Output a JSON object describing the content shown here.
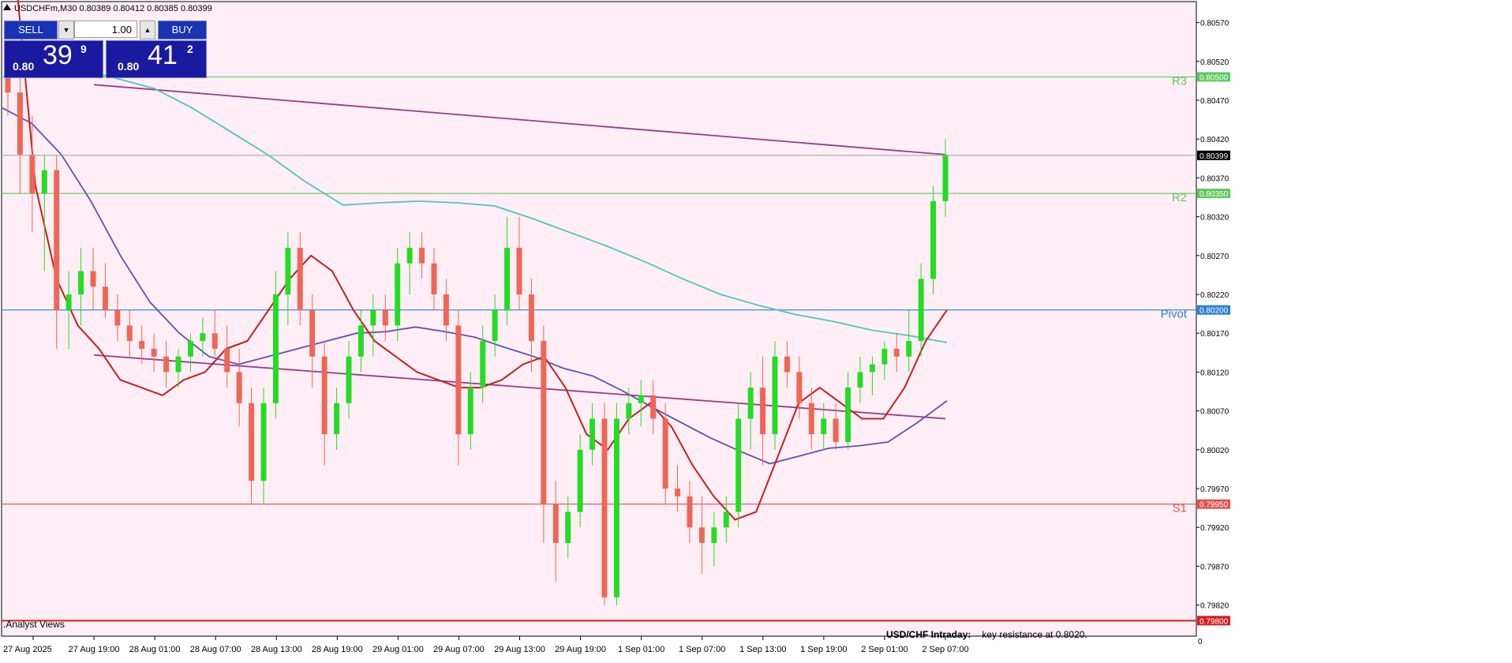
{
  "header": {
    "symbol_line": "USDCHFm,M30  0.80389 0.80412 0.80385 0.80399"
  },
  "trade_panel": {
    "sell_label": "SELL",
    "buy_label": "BUY",
    "lot_value": "1.00",
    "sell_price_prefix": "0.80",
    "sell_price_big": "39",
    "sell_price_sup": "9",
    "buy_price_prefix": "0.80",
    "buy_price_big": "41",
    "buy_price_sup": "2"
  },
  "footer": {
    "analyst": "Analyst Views",
    "intraday_title": "USD/CHF Intraday:",
    "intraday_text": "key resistance at 0.8020."
  },
  "chart_data": {
    "type": "candlestick",
    "symbol": "USDCHFm",
    "timeframe": "M30",
    "ylim": [
      0.7978,
      0.80597
    ],
    "y_ticks": [
      "0.80570",
      "0.80520",
      "0.80470",
      "0.80420",
      "0.80370",
      "0.80320",
      "0.80270",
      "0.80220",
      "0.80170",
      "0.80120",
      "0.80070",
      "0.80020",
      "0.79970",
      "0.79920",
      "0.79870",
      "0.79820"
    ],
    "current_price": "0.80399",
    "x_labels": [
      "27 Aug 2025",
      "27 Aug 19:00",
      "28 Aug 01:00",
      "28 Aug 07:00",
      "28 Aug 13:00",
      "28 Aug 19:00",
      "29 Aug 01:00",
      "29 Aug 07:00",
      "29 Aug 13:00",
      "29 Aug 19:00",
      "1 Sep 01:00",
      "1 Sep 07:00",
      "1 Sep 13:00",
      "1 Sep 19:00",
      "2 Sep 01:00",
      "2 Sep 07:00"
    ],
    "levels": [
      {
        "name": "R3",
        "value": 0.805,
        "label": "0.80500",
        "color": "#5ec95e"
      },
      {
        "name": "R2",
        "value": 0.8035,
        "label": "0.80350",
        "color": "#5ec95e"
      },
      {
        "name": "Pivot",
        "value": 0.802,
        "label": "0.80200",
        "color": "#2a7fd4"
      },
      {
        "name": "S1",
        "value": 0.7995,
        "label": "0.79950",
        "color": "#e05050"
      },
      {
        "name": "",
        "value": 0.798,
        "label": "0.79800",
        "color": "#d02020"
      }
    ],
    "trendlines": [
      {
        "from": [
          "27 Aug 19:00",
          0.8049
        ],
        "to": [
          "2 Sep 07:00",
          0.804
        ],
        "color": "#9b3a8a"
      },
      {
        "from": [
          "27 Aug 19:00",
          0.80142
        ],
        "to": [
          "2 Sep 07:00",
          0.8006
        ],
        "color": "#9b3a8a"
      }
    ],
    "ma_fast": [
      0.8065,
      0.8036,
      0.8024,
      0.8018,
      0.8015,
      0.8011,
      0.801,
      0.8009,
      0.8011,
      0.8012,
      0.8015,
      0.8016,
      0.802,
      0.8024,
      0.8027,
      0.8025,
      0.802,
      0.8016,
      0.8014,
      0.8012,
      0.8011,
      0.801,
      0.801,
      0.8011,
      0.8013,
      0.8014,
      0.801,
      0.8004,
      0.8002,
      0.8006,
      0.8008,
      0.8005,
      0.8,
      0.7996,
      0.7993,
      0.7994,
      0.8001,
      0.8008,
      0.801,
      0.8008,
      0.8006,
      0.8006,
      0.801,
      0.8016,
      0.802
    ],
    "ma_mid": [
      0.8046,
      0.8044,
      0.804,
      0.8034,
      0.8027,
      0.8021,
      0.8017,
      0.8014,
      0.8013,
      0.8014,
      0.8015,
      0.8016,
      0.8017,
      0.80172,
      0.80178,
      0.80172,
      0.80165,
      0.80152,
      0.8014,
      0.80125,
      0.80115,
      0.80096,
      0.80075,
      0.80055,
      0.80035,
      0.80018,
      0.80002,
      0.80012,
      0.80022,
      0.80025,
      0.8003,
      0.80055,
      0.80083
    ],
    "ma_slow": [
      0.8051,
      0.80498,
      0.80485,
      0.8046,
      0.8043,
      0.804,
      0.80365,
      0.80335,
      0.80338,
      0.8034,
      0.80338,
      0.80334,
      0.80318,
      0.803,
      0.80282,
      0.80262,
      0.8024,
      0.8022,
      0.80206,
      0.80194,
      0.80185,
      0.80174,
      0.80167,
      0.80158
    ],
    "candles": [
      [
        0.8052,
        0.8052,
        0.8045,
        0.8048
      ],
      [
        0.8048,
        0.8052,
        0.8035,
        0.804
      ],
      [
        0.804,
        0.8045,
        0.803,
        0.8035
      ],
      [
        0.8035,
        0.804,
        0.8025,
        0.8038
      ],
      [
        0.8038,
        0.804,
        0.8015,
        0.802
      ],
      [
        0.802,
        0.8025,
        0.8015,
        0.8022
      ],
      [
        0.8022,
        0.8028,
        0.8018,
        0.8025
      ],
      [
        0.8025,
        0.8028,
        0.802,
        0.8023
      ],
      [
        0.8023,
        0.8026,
        0.8019,
        0.802
      ],
      [
        0.802,
        0.8022,
        0.8016,
        0.8018
      ],
      [
        0.8018,
        0.802,
        0.8014,
        0.8016
      ],
      [
        0.8016,
        0.8018,
        0.8013,
        0.8015
      ],
      [
        0.8015,
        0.8017,
        0.8012,
        0.8014
      ],
      [
        0.8014,
        0.8016,
        0.801,
        0.8012
      ],
      [
        0.8012,
        0.8015,
        0.801,
        0.8014
      ],
      [
        0.8014,
        0.8017,
        0.8012,
        0.8016
      ],
      [
        0.8016,
        0.8019,
        0.8014,
        0.8017
      ],
      [
        0.8017,
        0.802,
        0.8014,
        0.8015
      ],
      [
        0.8015,
        0.8018,
        0.801,
        0.8012
      ],
      [
        0.8012,
        0.8015,
        0.8005,
        0.8008
      ],
      [
        0.8008,
        0.801,
        0.7995,
        0.7998
      ],
      [
        0.7998,
        0.801,
        0.7995,
        0.8008
      ],
      [
        0.8008,
        0.8025,
        0.8006,
        0.8022
      ],
      [
        0.8022,
        0.803,
        0.8018,
        0.8028
      ],
      [
        0.8028,
        0.803,
        0.8018,
        0.802
      ],
      [
        0.802,
        0.8022,
        0.801,
        0.8014
      ],
      [
        0.8014,
        0.8016,
        0.8,
        0.8004
      ],
      [
        0.8004,
        0.801,
        0.8002,
        0.8008
      ],
      [
        0.8008,
        0.8016,
        0.8006,
        0.8014
      ],
      [
        0.8014,
        0.802,
        0.8012,
        0.8018
      ],
      [
        0.8018,
        0.8022,
        0.8014,
        0.802
      ],
      [
        0.802,
        0.8022,
        0.8016,
        0.8018
      ],
      [
        0.8018,
        0.8028,
        0.8016,
        0.8026
      ],
      [
        0.8026,
        0.803,
        0.8022,
        0.8028
      ],
      [
        0.8028,
        0.803,
        0.8024,
        0.8026
      ],
      [
        0.8026,
        0.8028,
        0.802,
        0.8022
      ],
      [
        0.8022,
        0.8024,
        0.8016,
        0.8018
      ],
      [
        0.8018,
        0.802,
        0.8,
        0.8004
      ],
      [
        0.8004,
        0.8012,
        0.8002,
        0.801
      ],
      [
        0.801,
        0.8018,
        0.8008,
        0.8016
      ],
      [
        0.8016,
        0.8022,
        0.8014,
        0.802
      ],
      [
        0.802,
        0.8032,
        0.8018,
        0.8028
      ],
      [
        0.8028,
        0.8032,
        0.802,
        0.8022
      ],
      [
        0.8022,
        0.8024,
        0.8012,
        0.8016
      ],
      [
        0.8016,
        0.8018,
        0.799,
        0.7995
      ],
      [
        0.7995,
        0.7998,
        0.7985,
        0.799
      ],
      [
        0.799,
        0.7996,
        0.7988,
        0.7994
      ],
      [
        0.7994,
        0.8004,
        0.7992,
        0.8002
      ],
      [
        0.8002,
        0.8008,
        0.8,
        0.8006
      ],
      [
        0.8006,
        0.8008,
        0.7982,
        0.7983
      ],
      [
        0.7983,
        0.8008,
        0.7982,
        0.8006
      ],
      [
        0.8006,
        0.801,
        0.8004,
        0.8008
      ],
      [
        0.8008,
        0.8011,
        0.8005,
        0.8009
      ],
      [
        0.8009,
        0.8011,
        0.8004,
        0.8006
      ],
      [
        0.8006,
        0.8008,
        0.7995,
        0.7997
      ],
      [
        0.7997,
        0.8,
        0.7994,
        0.7996
      ],
      [
        0.7996,
        0.7998,
        0.799,
        0.7992
      ],
      [
        0.7992,
        0.7996,
        0.7986,
        0.799
      ],
      [
        0.799,
        0.7994,
        0.7987,
        0.7992
      ],
      [
        0.7992,
        0.7996,
        0.799,
        0.7994
      ],
      [
        0.7994,
        0.8008,
        0.7992,
        0.8006
      ],
      [
        0.8006,
        0.8012,
        0.8002,
        0.801
      ],
      [
        0.801,
        0.8014,
        0.8,
        0.8004
      ],
      [
        0.8004,
        0.8016,
        0.8002,
        0.8014
      ],
      [
        0.8014,
        0.8016,
        0.801,
        0.8012
      ],
      [
        0.8012,
        0.8014,
        0.8006,
        0.8008
      ],
      [
        0.8008,
        0.801,
        0.8002,
        0.8004
      ],
      [
        0.8004,
        0.8008,
        0.8002,
        0.8006
      ],
      [
        0.8006,
        0.8008,
        0.8002,
        0.8003
      ],
      [
        0.8003,
        0.8012,
        0.8002,
        0.801
      ],
      [
        0.801,
        0.8014,
        0.8008,
        0.8012
      ],
      [
        0.8012,
        0.8014,
        0.8009,
        0.8013
      ],
      [
        0.8013,
        0.8016,
        0.8011,
        0.8015
      ],
      [
        0.8015,
        0.8017,
        0.8012,
        0.8014
      ],
      [
        0.8014,
        0.802,
        0.8012,
        0.8016
      ],
      [
        0.8016,
        0.8026,
        0.8014,
        0.8024
      ],
      [
        0.8024,
        0.8036,
        0.8022,
        0.8034
      ],
      [
        0.8034,
        0.8042,
        0.8032,
        0.804
      ]
    ]
  }
}
